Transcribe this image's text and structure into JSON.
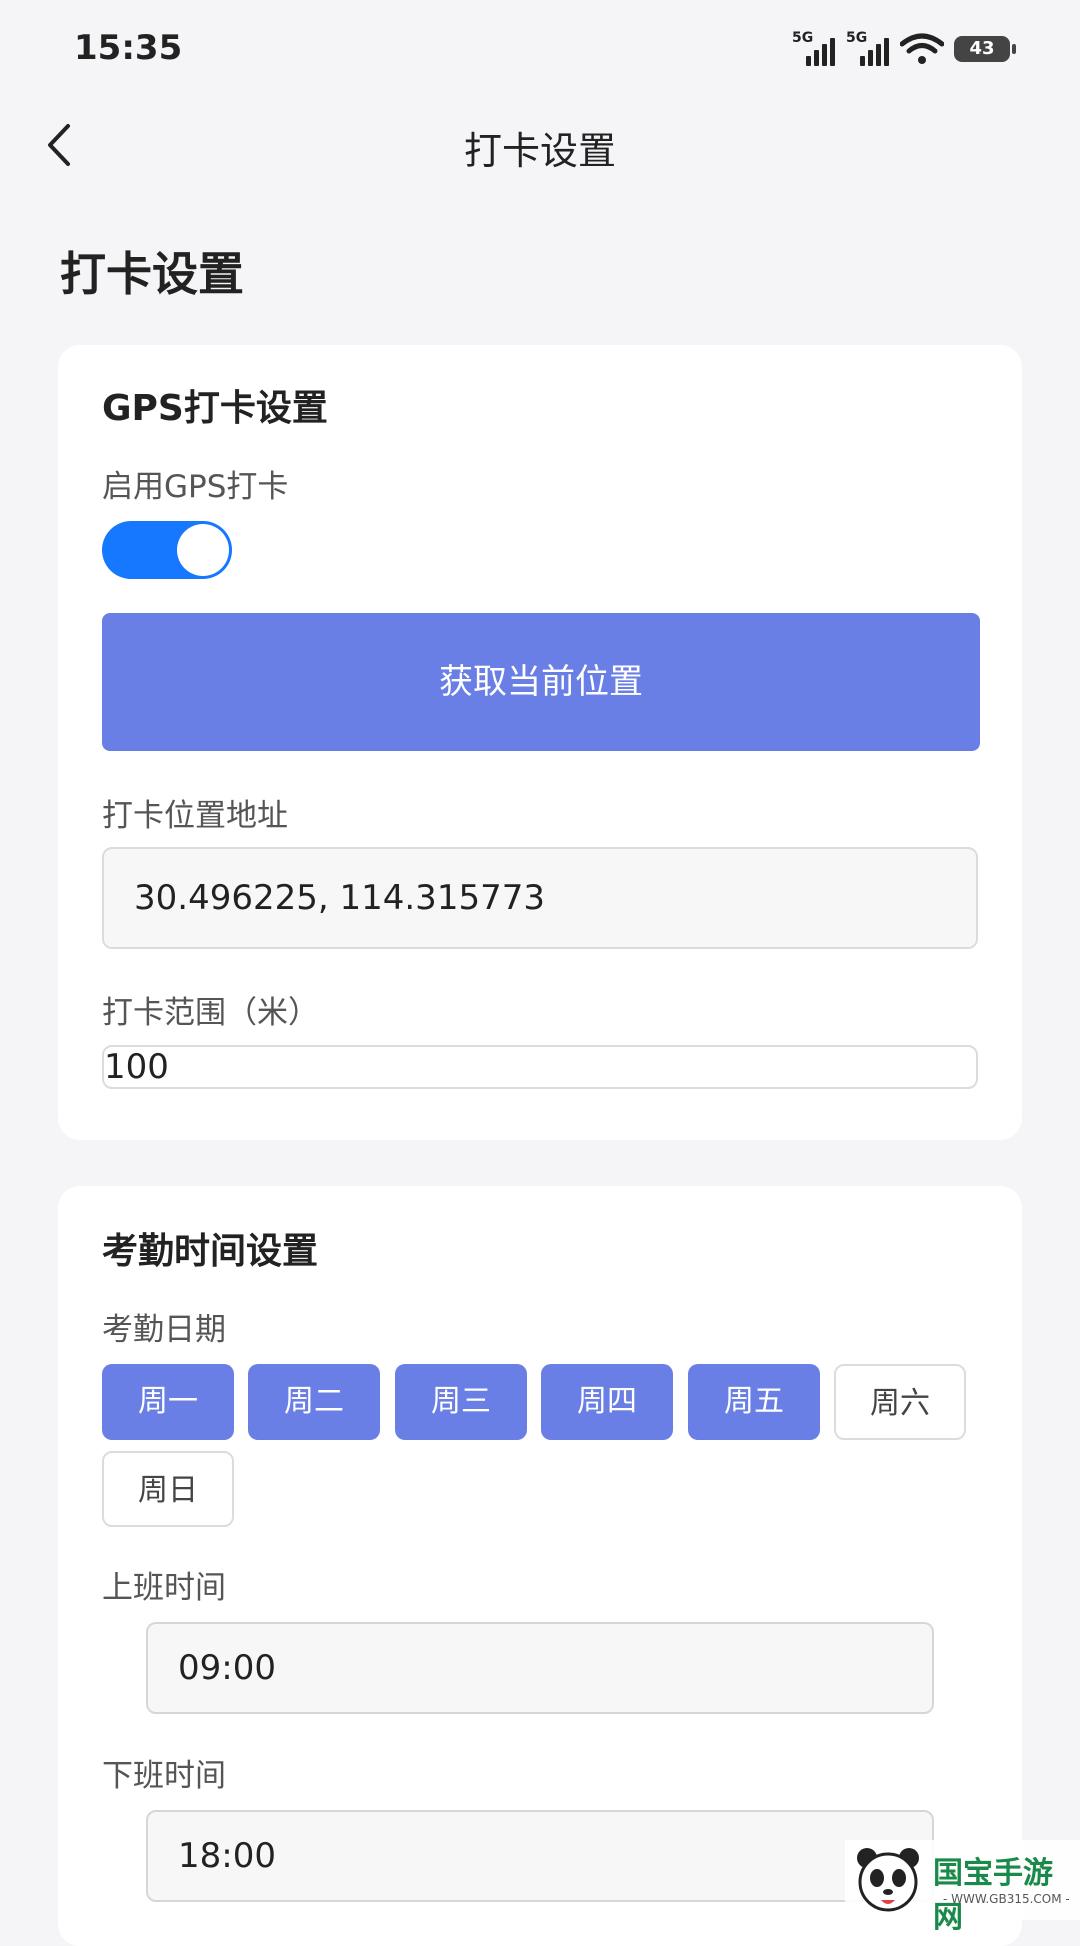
{
  "status_bar": {
    "time": "15:35",
    "signal1": "5G",
    "signal2": "5G",
    "battery": "43"
  },
  "nav": {
    "title": "打卡设置"
  },
  "page_title": "打卡设置",
  "gps": {
    "title": "GPS打卡设置",
    "enable_label": "启用GPS打卡",
    "enabled": true,
    "get_location_button": "获取当前位置",
    "address_label": "打卡位置地址",
    "address_value": "30.496225, 114.315773",
    "range_label": "打卡范围（米）",
    "range_value": "100"
  },
  "attendance": {
    "title": "考勤时间设置",
    "date_label": "考勤日期",
    "days": [
      {
        "label": "周一",
        "selected": true
      },
      {
        "label": "周二",
        "selected": true
      },
      {
        "label": "周三",
        "selected": true
      },
      {
        "label": "周四",
        "selected": true
      },
      {
        "label": "周五",
        "selected": true
      },
      {
        "label": "周六",
        "selected": false
      },
      {
        "label": "周日",
        "selected": false
      }
    ],
    "start_label": "上班时间",
    "start_value": "09:00",
    "end_label": "下班时间",
    "end_value": "18:00"
  },
  "watermark": {
    "name": "国宝手游网",
    "url": "- WWW.GB315.COM -"
  },
  "colors": {
    "accent": "#6a7fe6",
    "toggle": "#1677ff"
  }
}
